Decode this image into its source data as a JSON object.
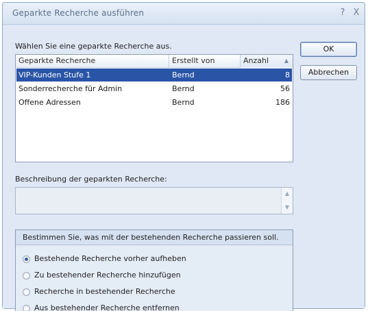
{
  "window": {
    "title": "Geparkte Recherche ausführen",
    "help_glyph": "?",
    "close_glyph": "X"
  },
  "list": {
    "prompt": "Wählen Sie eine geparkte Recherche aus.",
    "columns": [
      "Geparkte Recherche",
      "Erstellt von",
      "Anzahl"
    ],
    "rows": [
      {
        "name": "VIP-Kunden Stufe 1",
        "author": "Bernd",
        "count": "8",
        "selected": true
      },
      {
        "name": "Sonderrecherche für Admin",
        "author": "Bernd",
        "count": "56",
        "selected": false
      },
      {
        "name": "Offene Adressen",
        "author": "Bernd",
        "count": "186",
        "selected": false
      }
    ],
    "sort_glyph": "▲"
  },
  "buttons": {
    "ok": "OK",
    "cancel": "Abbrechen"
  },
  "description": {
    "label": "Beschreibung der geparkten Recherche:",
    "value": "",
    "scroll_up": "▲",
    "scroll_down": "▼"
  },
  "action_group": {
    "title": "Bestimmen Sie, was mit der bestehenden Recherche passieren soll.",
    "options": [
      {
        "label": "Bestehende Recherche vorher aufheben",
        "checked": true
      },
      {
        "label": "Zu bestehender Recherche hinzufügen",
        "checked": false
      },
      {
        "label": "Recherche in bestehender Recherche",
        "checked": false
      },
      {
        "label": "Aus bestehender Recherche entfernen",
        "checked": false
      }
    ]
  },
  "colors": {
    "selection": "#2a55a6",
    "dialog_background": "#dfe8f4"
  }
}
